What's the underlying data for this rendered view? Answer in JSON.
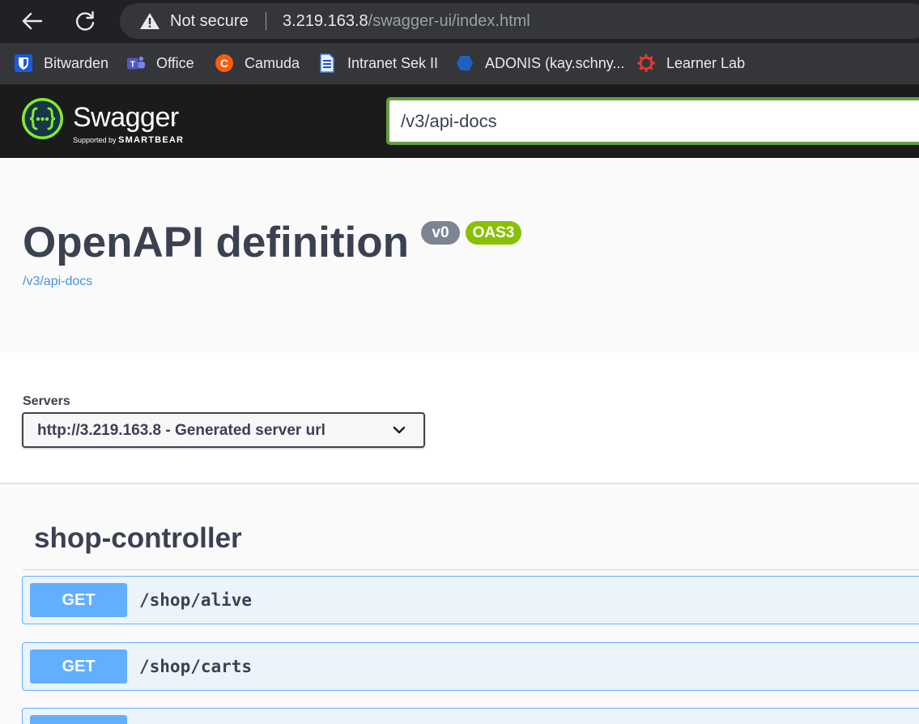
{
  "browser": {
    "security_label": "Not secure",
    "url_host": "3.219.163.8",
    "url_path": "/swagger-ui/index.html"
  },
  "bookmarks": [
    {
      "label": "Bitwarden",
      "icon": "bitwarden-icon"
    },
    {
      "label": "Office",
      "icon": "teams-icon"
    },
    {
      "label": "Camuda",
      "icon": "camunda-icon"
    },
    {
      "label": "Intranet Sek II",
      "icon": "document-icon"
    },
    {
      "label": "ADONIS (kay.schny...",
      "icon": "hexagon-icon"
    },
    {
      "label": "Learner Lab",
      "icon": "canvas-icon"
    }
  ],
  "swagger": {
    "brand": "Swagger",
    "tm": "™",
    "supported_by": "Supported by",
    "smartbear": "SMARTBEAR",
    "url_input_value": "/v3/api-docs"
  },
  "info": {
    "title": "OpenAPI definition",
    "version": "v0",
    "oas": "OAS3",
    "link": "/v3/api-docs"
  },
  "servers": {
    "label": "Servers",
    "selected": "http://3.219.163.8 - Generated server url"
  },
  "tag": {
    "name": "shop-controller",
    "operations": [
      {
        "method": "GET",
        "path": "/shop/alive"
      },
      {
        "method": "GET",
        "path": "/shop/carts"
      },
      {
        "method": "",
        "path": ""
      }
    ]
  },
  "colors": {
    "get_method": "#61affe",
    "oas_badge": "#89bf04",
    "version_badge": "#7d8492",
    "url_input_border": "#62a03f"
  }
}
